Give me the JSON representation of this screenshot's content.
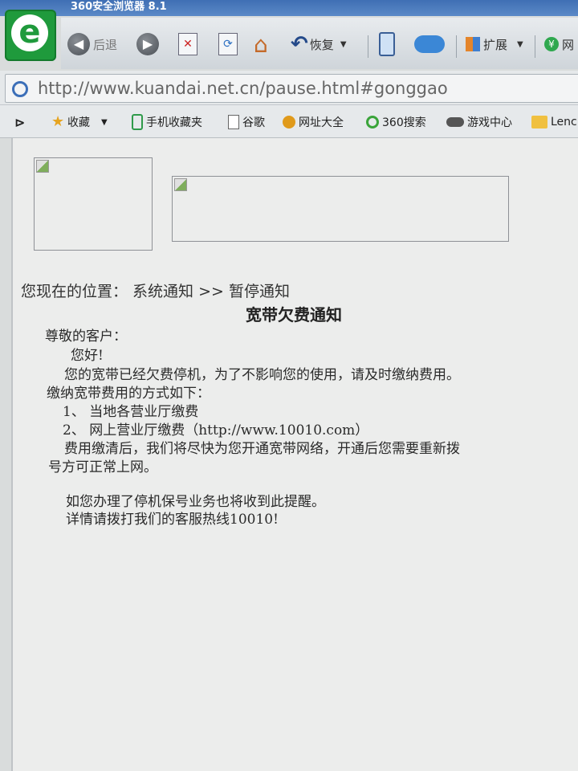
{
  "window": {
    "title": "360安全浏览器 8.1"
  },
  "toolbar": {
    "back_label": "后退",
    "restore_label": "恢复",
    "extensions_label": "扩展",
    "partial_label": "网"
  },
  "address": {
    "url": "http://www.kuandai.net.cn/pause.html#gonggao"
  },
  "bookmarks": {
    "items": [
      {
        "label": "收藏",
        "icon": "star-icon"
      },
      {
        "label": "手机收藏夹",
        "icon": "phone-icon"
      },
      {
        "label": "谷歌",
        "icon": "page-icon"
      },
      {
        "label": "网址大全",
        "icon": "globe-icon"
      },
      {
        "label": "360搜索",
        "icon": "search360-icon"
      },
      {
        "label": "游戏中心",
        "icon": "gamepad-icon"
      },
      {
        "label": "Lenc",
        "icon": "folder-icon"
      }
    ]
  },
  "page": {
    "breadcrumb": "您现在的位置：  系统通知 >> 暂停通知",
    "title": "宽带欠费通知",
    "lines": [
      "尊敬的客户：",
      "您好!",
      "您的宽带已经欠费停机，为了不影响您的使用，请及时缴纳费用。",
      "缴纳宽带费用的方式如下：",
      "1、 当地各营业厅缴费",
      "2、 网上营业厅缴费（http://www.10010.com）",
      "费用缴清后，我们将尽快为您开通宽带网络，开通后您需要重新拨",
      "号方可正常上网。",
      "如您办理了停机保号业务也将收到此提醒。",
      "详情请拨打我们的客服热线10010!"
    ]
  },
  "colors": {
    "accent": "#3c6fb8",
    "brand_green": "#1f9a3c",
    "page_bg": "#ecedec"
  }
}
